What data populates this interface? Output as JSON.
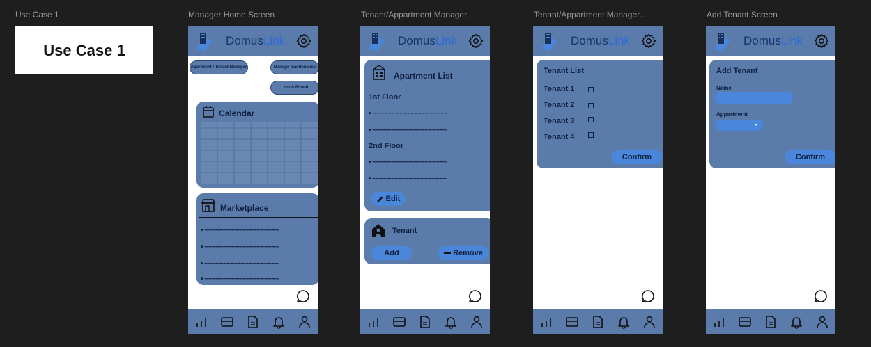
{
  "frames": {
    "f1": "Use Case 1",
    "f2": "Manager Home Screen",
    "f3": "Tenant/Appartment Manager...",
    "f4": "Tenant/Appartment Manager...",
    "f5": "Add Tenant Screen"
  },
  "usecase_card": "Use Case 1",
  "brand": {
    "prefix": "Domus",
    "suffix": "Link"
  },
  "colors": {
    "panel": "#5b7bab",
    "accent": "#4a86d9",
    "brand_dark": "#16356e",
    "brand_link": "#2d6bd7"
  },
  "home": {
    "btn_apartment": "Apartment / Tenant Manager",
    "btn_maintenance": "Manage Maintenance",
    "btn_lost": "Lost & Found",
    "calendar_title": "Calendar",
    "marketplace_title": "Marketplace",
    "market_items": [
      "~~~~~~~~~~~~~~~~~~~~",
      "~~~~~~~~~~~~~~~~~~~~",
      "~~~~~~~~~~~~~~~~~~~~",
      "~~~~~~~~~~~~~~~~~~~~"
    ]
  },
  "apt": {
    "list_title": "Apartment List",
    "floor1": "1st Floor",
    "floor2": "2nd Floor",
    "items": [
      "~~~~~~~~~~~~~~~~~~~~",
      "~~~~~~~~~~~~~~~~~~~~",
      "~~~~~~~~~~~~~~~~~~~~",
      "~~~~~~~~~~~~~~~~~~~~"
    ],
    "edit": "Edit",
    "tenant_title": "Tenant",
    "add": "Add",
    "remove": "Remove"
  },
  "tenant_list": {
    "title": "Tenant List",
    "tenants": [
      "Tenant 1",
      "Tenant 2",
      "Tenant 3",
      "Tenant 4"
    ],
    "confirm": "Confirm"
  },
  "add_tenant": {
    "title": "Add Tenant",
    "name_label": "Name",
    "apartment_label": "Appartment",
    "confirm": "Confirm"
  },
  "icons": [
    "logo-icon",
    "gear-icon",
    "chat-icon",
    "chart-icon",
    "card-icon",
    "document-icon",
    "bell-icon",
    "user-icon",
    "calendar-icon",
    "store-icon",
    "building-icon",
    "house-person-icon",
    "pencil-icon",
    "minus-icon"
  ]
}
